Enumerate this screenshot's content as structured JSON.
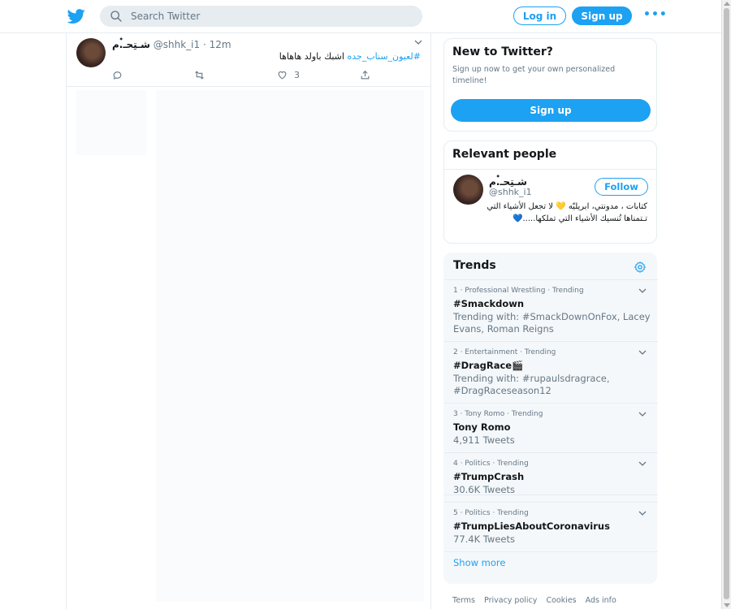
{
  "topbar": {
    "search_placeholder": "Search Twitter",
    "login_label": "Log in",
    "signup_label": "Sign up",
    "more_label": "•••"
  },
  "tweet": {
    "name": "شـتِحـ๋.م",
    "handle": "@shhk_i1",
    "separator": "·",
    "time": "12m",
    "hashtag": "#لعيون_سناب_جده",
    "text": " اشبك باولد هاهاها",
    "reply_count": "",
    "retweet_count": "",
    "like_count": "3"
  },
  "new_to_twitter": {
    "title": "New to Twitter?",
    "description": "Sign up now to get your own personalized timeline!",
    "signup_label": "Sign up"
  },
  "relevant_people": {
    "title": "Relevant people",
    "person": {
      "name": "شـتِحـ๋.م",
      "handle": "@shhk_i1",
      "follow_label": "Follow",
      "bio": "كتابات ، مدونتي، ابريليّه 💛 لا تجعل الأشياء التي تـتمناها تُنسيك الأشياء التي تملكها.....💙"
    }
  },
  "trends": {
    "title": "Trends",
    "items": [
      {
        "meta": "1 · Professional Wrestling · Trending",
        "name": "#Smackdown",
        "sub": "Trending with: #SmackDownOnFox, Lacey Evans, Roman Reigns"
      },
      {
        "meta": "2 · Entertainment · Trending",
        "name": "#DragRace🎬",
        "sub": "Trending with: #rupaulsdragrace, #DragRaceseason12"
      },
      {
        "meta": "3 · Tony Romo · Trending",
        "name": "Tony Romo",
        "sub": "4,911 Tweets"
      },
      {
        "meta": "4 · Politics · Trending",
        "name": "#TrumpCrash",
        "sub": "30.6K Tweets"
      },
      {
        "meta": "5 · Politics · Trending",
        "name": "#TrumpLiesAboutCoronavirus",
        "sub": "77.4K Tweets"
      }
    ],
    "show_more": "Show more"
  },
  "footer": {
    "links": [
      "Terms",
      "Privacy policy",
      "Cookies",
      "Ads info"
    ]
  },
  "colors": {
    "brand_blue": "#1da1f2",
    "secondary_text": "#657786",
    "border": "#e6ecf0",
    "trends_bg": "#f5f8fa"
  }
}
